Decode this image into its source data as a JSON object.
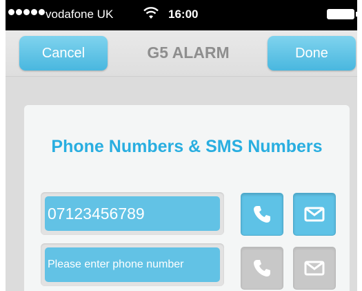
{
  "status_bar": {
    "carrier": "vodafone UK",
    "time": "16:00",
    "signal_bars": 5,
    "wifi_icon": "wifi-icon",
    "battery_icon": "battery-icon"
  },
  "nav": {
    "cancel_label": "Cancel",
    "title": "G5 ALARM",
    "done_label": "Done"
  },
  "card": {
    "title": "Phone Numbers & SMS Numbers",
    "rows": [
      {
        "value": "07123456789",
        "placeholder": "",
        "call_icon": "phone-icon",
        "sms_icon": "envelope-icon",
        "active": true
      },
      {
        "value": "",
        "placeholder": "Please enter phone number",
        "call_icon": "phone-icon",
        "sms_icon": "envelope-icon",
        "active": false
      }
    ]
  },
  "colors": {
    "accent": "#29aee0",
    "button_blue": "#5ec2e6",
    "button_grey": "#c8c8c8",
    "nav_title": "#8e8e8e"
  }
}
